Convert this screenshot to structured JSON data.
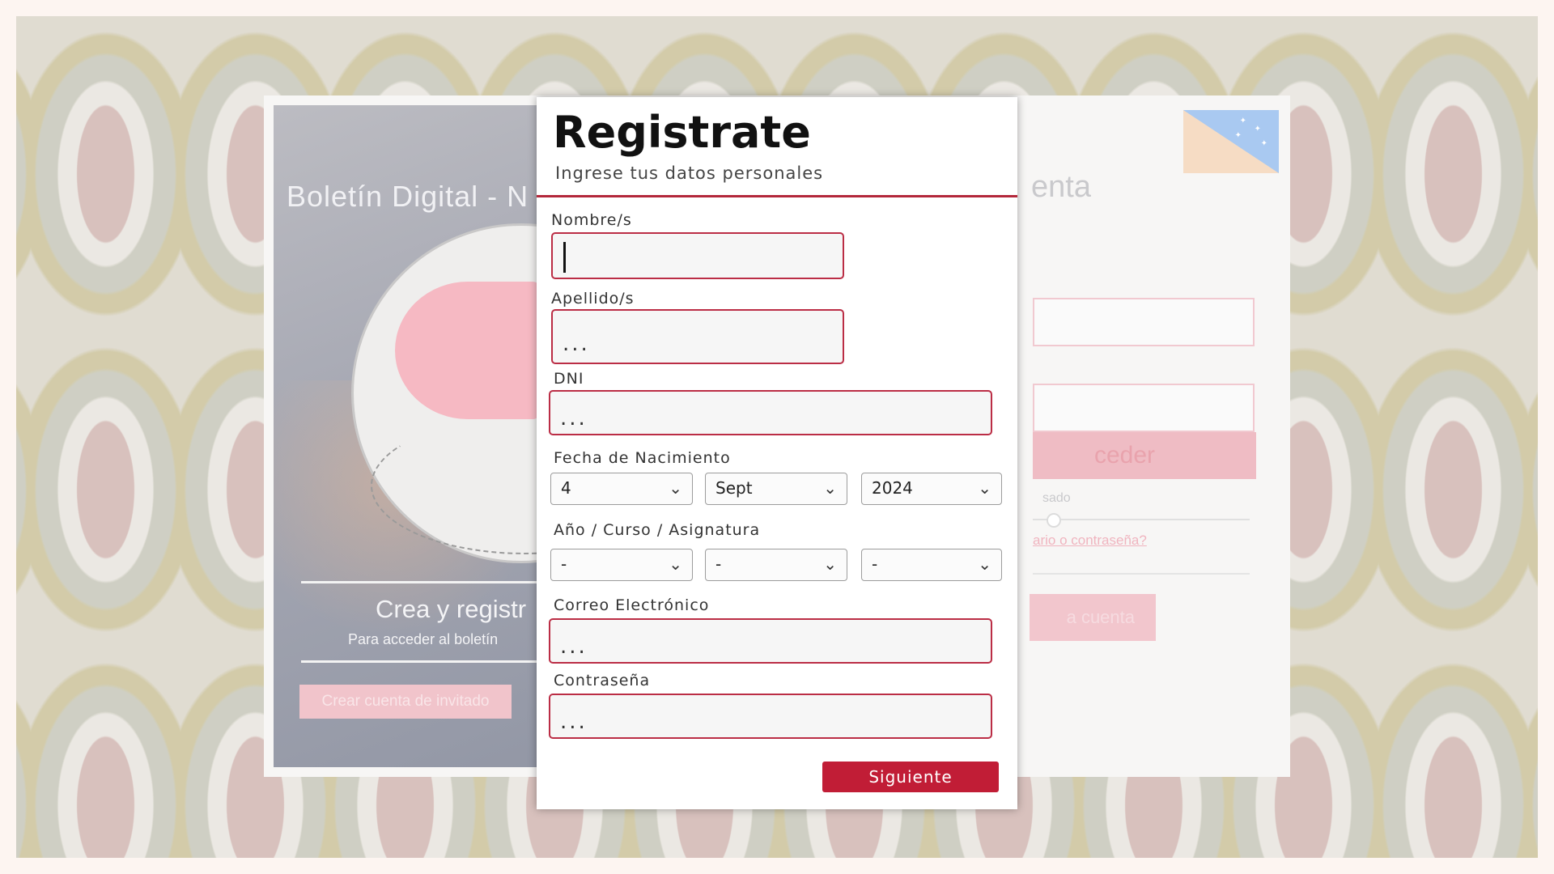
{
  "background": {
    "login_page": {
      "left": {
        "title": "Boletín Digital - N",
        "headline": "Crea y registr",
        "subline": "Para acceder al boletín",
        "guest_button": "Crear cuenta de invitado"
      },
      "right": {
        "title_fragment": "enta",
        "access_button": "ceder",
        "remember_fragment": "sado",
        "forgot_link": "ario o contraseña?",
        "create_account_fragment": "a cuenta"
      }
    }
  },
  "modal": {
    "title": "Registrate",
    "subtitle": "Ingrese tus datos personales",
    "fields": {
      "nombre": {
        "label": "Nombre/s",
        "value": ""
      },
      "apellido": {
        "label": "Apellido/s",
        "placeholder": "..."
      },
      "dni": {
        "label": "DNI",
        "placeholder": "..."
      },
      "fecha": {
        "label": "Fecha de Nacimiento",
        "day": "4",
        "month": "Sept",
        "year": "2024"
      },
      "curso": {
        "label": "Año / Curso / Asignatura",
        "anio": "-",
        "curso": "-",
        "asignatura": "-"
      },
      "correo": {
        "label": "Correo Electrónico",
        "placeholder": "..."
      },
      "contrasena": {
        "label": "Contraseña",
        "placeholder": "..."
      }
    },
    "next_button": "Siguiente"
  },
  "colors": {
    "accent": "#c11d36",
    "field_border": "#bb2d45"
  }
}
